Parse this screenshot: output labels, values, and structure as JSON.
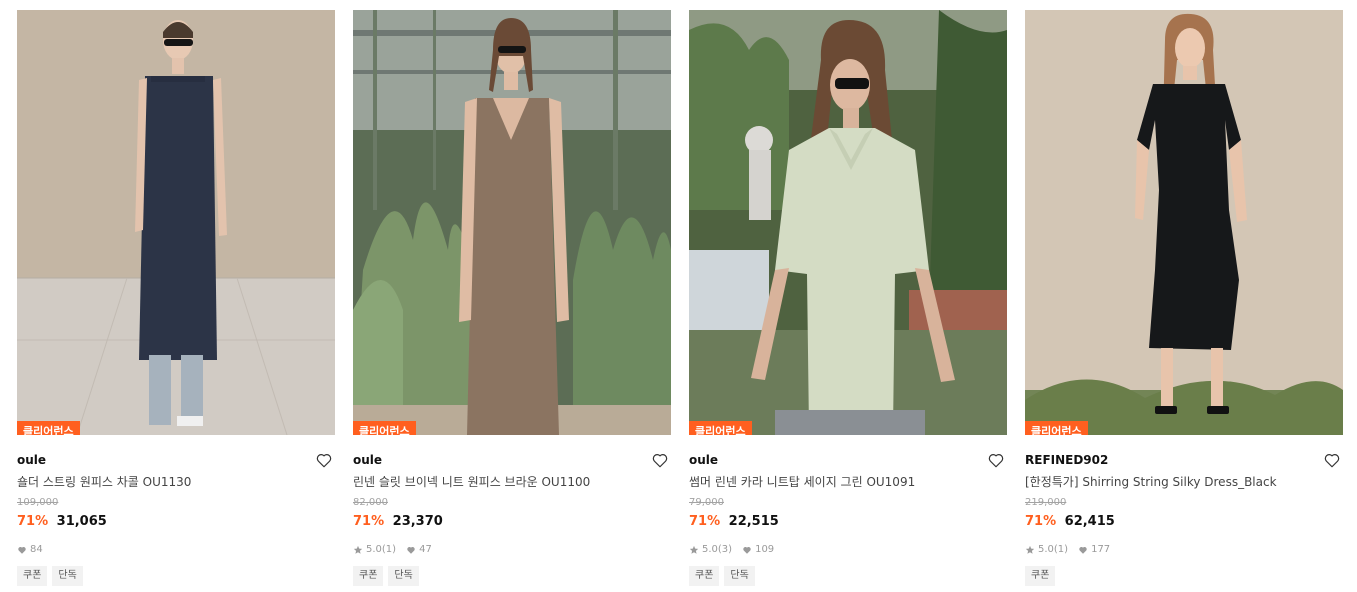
{
  "products": [
    {
      "badge": "클리어런스",
      "brand": "oule",
      "name": "숄더 스트링 원피스 차콜 OU1130",
      "original_price": "109,000",
      "discount": "71%",
      "price": "31,065",
      "rating": "",
      "review_count": "",
      "likes": "84",
      "tags": [
        "쿠폰",
        "단독"
      ],
      "image_desc": "model-in-charcoal-dress"
    },
    {
      "badge": "클리어런스",
      "brand": "oule",
      "name": "린넨 슬릿 브이넥 니트 원피스 브라운 OU1100",
      "original_price": "82,000",
      "discount": "71%",
      "price": "23,370",
      "rating": "5.0",
      "review_count": "(1)",
      "likes": "47",
      "tags": [
        "쿠폰",
        "단독"
      ],
      "image_desc": "model-in-brown-knit-dress"
    },
    {
      "badge": "클리어런스",
      "brand": "oule",
      "name": "썸머 린넨 카라 니트탑 세이지 그린 OU1091",
      "original_price": "79,000",
      "discount": "71%",
      "price": "22,515",
      "rating": "5.0",
      "review_count": "(3)",
      "likes": "109",
      "tags": [
        "쿠폰",
        "단독"
      ],
      "image_desc": "model-in-sage-green-knit-top"
    },
    {
      "badge": "클리어런스",
      "brand": "REFINED902",
      "name": "[한정특가] Shirring String Silky Dress_Black",
      "original_price": "219,000",
      "discount": "71%",
      "price": "62,415",
      "rating": "5.0",
      "review_count": "(1)",
      "likes": "177",
      "tags": [
        "쿠폰"
      ],
      "image_desc": "model-in-black-silky-dress"
    }
  ],
  "colors": {
    "accent": "#ff5f1f",
    "muted": "#9a9a9a"
  }
}
